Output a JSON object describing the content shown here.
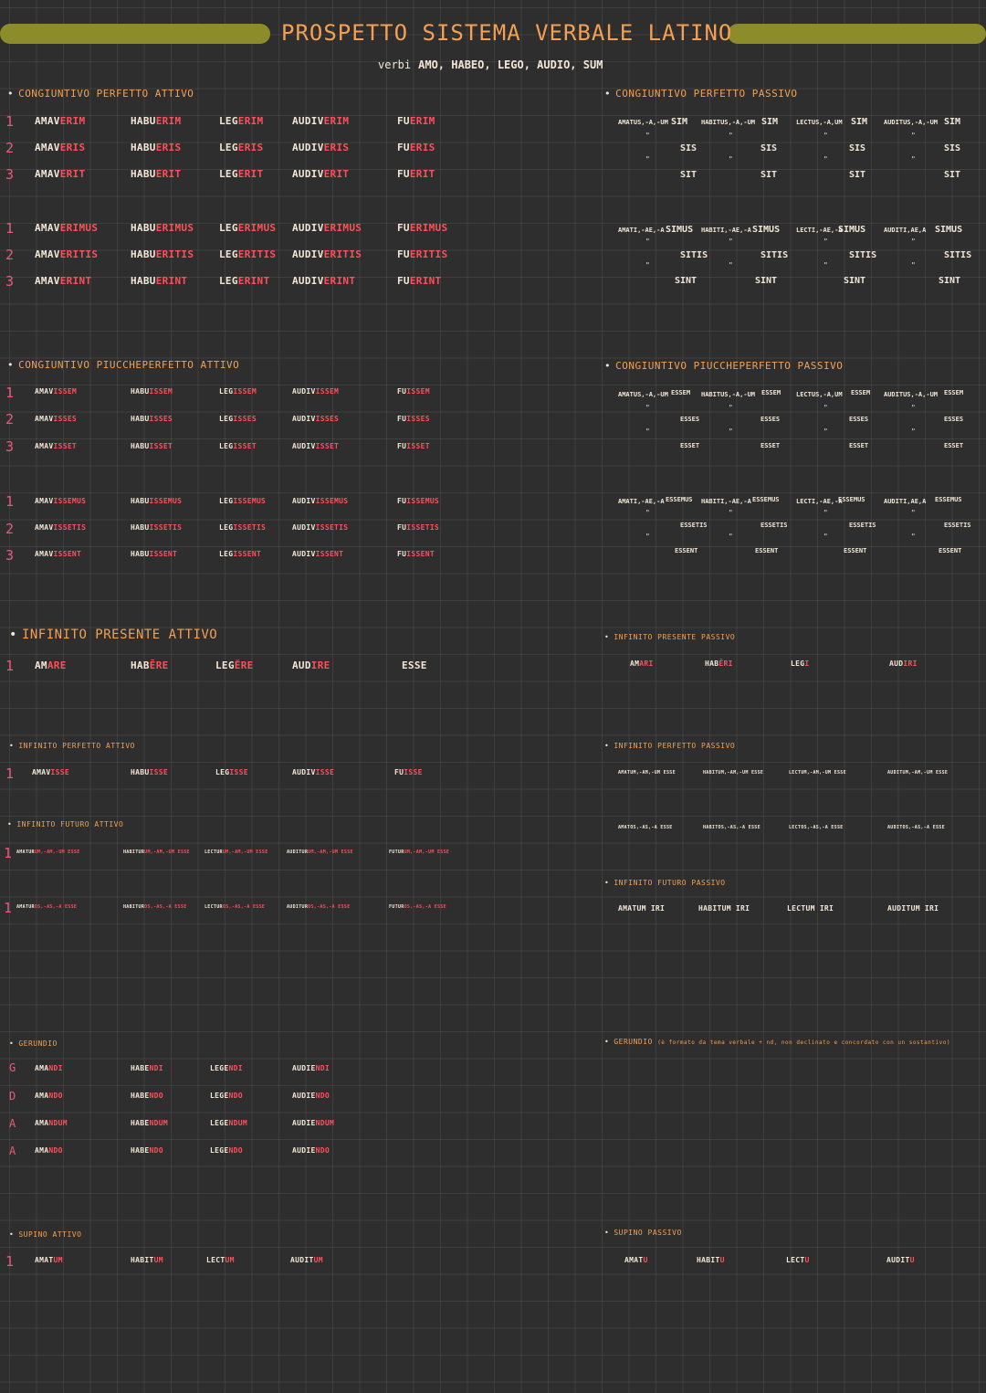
{
  "title": "PROSPETTO SISTEMA VERBALE LATINO",
  "subtitle": {
    "label": "verbi",
    "verbs": "AMO, HABEO, LEGO, AUDIO, SUM"
  },
  "colors": {
    "background": "#2e2e2e",
    "heading": "#f4a052",
    "ending": "#ff4f5a",
    "number": "#e85a7c",
    "bar": "#8c8c2a",
    "text": "#f2e6d6"
  },
  "sections": {
    "cong_perf_att": "CONGIUNTIVO PERFETTO ATTIVO",
    "cong_perf_pass": "CONGIUNTIVO PERFETTO PASSIVO",
    "cong_piuc_att": "CONGIUNTIVO PIUCCHEPERFETTO ATTIVO",
    "cong_piuc_pass": "CONGIUNTIVO PIUCCHEPERFETTO PASSIVO",
    "inf_pres_att": "INFINITO PRESENTE ATTIVO",
    "inf_pres_pass": "INFINITO PRESENTE PASSIVO",
    "inf_perf_att": "INFINITO PERFETTO ATTIVO",
    "inf_perf_pass": "INFINITO PERFETTO PASSIVO",
    "inf_fut_att": "INFINITO FUTURO ATTIVO",
    "inf_fut_pass": "INFINITO FUTURO PASSIVO",
    "gerundio_l": "GERUNDIO",
    "gerundio_r": "GERUNDIO",
    "gerundio_note": "(è formato da tema verbale + nd, non declinato e concordato con un sostantivo)",
    "supino_att": "SUPINO ATTIVO",
    "supino_pass": "SUPINO PASSIVO"
  },
  "nums": {
    "n1": "1",
    "n2": "2",
    "n3": "3",
    "g": "G",
    "d": "D",
    "a": "A",
    "ab": "A"
  },
  "cpa": {
    "r1": [
      [
        "AMAV",
        "ERIM"
      ],
      [
        "HABU",
        "ERIM"
      ],
      [
        "LEG",
        "ERIM"
      ],
      [
        "AUDIV",
        "ERIM"
      ],
      [
        "FU",
        "ERIM"
      ]
    ],
    "r2": [
      [
        "AMAV",
        "ERIS"
      ],
      [
        "HABU",
        "ERIS"
      ],
      [
        "LEG",
        "ERIS"
      ],
      [
        "AUDIV",
        "ERIS"
      ],
      [
        "FU",
        "ERIS"
      ]
    ],
    "r3": [
      [
        "AMAV",
        "ERIT"
      ],
      [
        "HABU",
        "ERIT"
      ],
      [
        "LEG",
        "ERIT"
      ],
      [
        "AUDIV",
        "ERIT"
      ],
      [
        "FU",
        "ERIT"
      ]
    ],
    "r4": [
      [
        "AMAV",
        "ERIMUS"
      ],
      [
        "HABU",
        "ERIMUS"
      ],
      [
        "LEG",
        "ERIMUS"
      ],
      [
        "AUDIV",
        "ERIMUS"
      ],
      [
        "FU",
        "ERIMUS"
      ]
    ],
    "r5": [
      [
        "AMAV",
        "ERITIS"
      ],
      [
        "HABU",
        "ERITIS"
      ],
      [
        "LEG",
        "ERITIS"
      ],
      [
        "AUDIV",
        "ERITIS"
      ],
      [
        "FU",
        "ERITIS"
      ]
    ],
    "r6": [
      [
        "AMAV",
        "ERINT"
      ],
      [
        "HABU",
        "ERINT"
      ],
      [
        "LEG",
        "ERINT"
      ],
      [
        "AUDIV",
        "ERINT"
      ],
      [
        "FU",
        "ERINT"
      ]
    ]
  },
  "cpp": {
    "p_sg": [
      "AMATUS,-A,-UM",
      "HABITUS,-A,-UM",
      "LECTUS,-A,UM",
      "AUDITUS,-A,-UM"
    ],
    "p_pl": [
      "AMATI,-AE,-A",
      "HABITI,-AE,-A",
      "LECTI,-AE,-A",
      "AUDITI,AE,A"
    ],
    "aux_sg": [
      "SIM",
      "SIS",
      "SIT"
    ],
    "aux_pl": [
      "SIMUS",
      "SITIS",
      "SINT"
    ]
  },
  "cppa": {
    "r1": [
      [
        "AMAV",
        "ISSEM"
      ],
      [
        "HABU",
        "ISSEM"
      ],
      [
        "LEG",
        "ISSEM"
      ],
      [
        "AUDIV",
        "ISSEM"
      ],
      [
        "FU",
        "ISSEM"
      ]
    ],
    "r2": [
      [
        "AMAV",
        "ISSES"
      ],
      [
        "HABU",
        "ISSES"
      ],
      [
        "LEG",
        "ISSES"
      ],
      [
        "AUDIV",
        "ISSES"
      ],
      [
        "FU",
        "ISSES"
      ]
    ],
    "r3": [
      [
        "AMAV",
        "ISSET"
      ],
      [
        "HABU",
        "ISSET"
      ],
      [
        "LEG",
        "ISSET"
      ],
      [
        "AUDIV",
        "ISSET"
      ],
      [
        "FU",
        "ISSET"
      ]
    ],
    "r4": [
      [
        "AMAV",
        "ISSEMUS"
      ],
      [
        "HABU",
        "ISSEMUS"
      ],
      [
        "LEG",
        "ISSEMUS"
      ],
      [
        "AUDIV",
        "ISSEMUS"
      ],
      [
        "FU",
        "ISSEMUS"
      ]
    ],
    "r5": [
      [
        "AMAV",
        "ISSETIS"
      ],
      [
        "HABU",
        "ISSETIS"
      ],
      [
        "LEG",
        "ISSETIS"
      ],
      [
        "AUDIV",
        "ISSETIS"
      ],
      [
        "FU",
        "ISSETIS"
      ]
    ],
    "r6": [
      [
        "AMAV",
        "ISSENT"
      ],
      [
        "HABU",
        "ISSENT"
      ],
      [
        "LEG",
        "ISSENT"
      ],
      [
        "AUDIV",
        "ISSENT"
      ],
      [
        "FU",
        "ISSENT"
      ]
    ]
  },
  "cppp": {
    "p_sg": [
      "AMATUS,-A,-UM",
      "HABITUS,-A,-UM",
      "LECTUS,-A,UM",
      "AUDITUS,-A,-UM"
    ],
    "p_pl": [
      "AMATI,-AE,-A",
      "HABITI,-AE,-A",
      "LECTI,-AE,-A",
      "AUDITI,AE,A"
    ],
    "aux_sg": [
      "ESSEM",
      "ESSES",
      "ESSET"
    ],
    "aux_pl": [
      "ESSEMUS",
      "ESSETIS",
      "ESSENT"
    ]
  },
  "ditto": "\"",
  "ipa": [
    [
      "AM",
      "ARE"
    ],
    [
      "HAB",
      "ĒRE"
    ],
    [
      "LEG",
      "ĔRE"
    ],
    [
      "AUD",
      "IRE"
    ],
    [
      "ESSE",
      ""
    ]
  ],
  "ipp": [
    [
      "AM",
      "ARI"
    ],
    [
      "HAB",
      "ĒRI"
    ],
    [
      "LEG",
      "I"
    ],
    [
      "AUD",
      "IRI"
    ]
  ],
  "iperfa": [
    [
      "AMAV",
      "ISSE"
    ],
    [
      "HABU",
      "ISSE"
    ],
    [
      "LEG",
      "ISSE"
    ],
    [
      "AUDIV",
      "ISSE"
    ],
    [
      "FU",
      "ISSE"
    ]
  ],
  "iperfp": {
    "sg": [
      "AMATUM,-AM,-UM ESSE",
      "HABITUM,-AM,-UM ESSE",
      "LECTUM,-AM,-UM ESSE",
      "AUDITUM,-AM,-UM ESSE"
    ],
    "pl": [
      "AMATOS,-AS,-A ESSE",
      "HABITOS,-AS,-A ESSE",
      "LECTOS,-AS,-A ESSE",
      "AUDITOS,-AS,-A ESSE"
    ]
  },
  "ifa": {
    "sg": [
      [
        "AMATUR",
        "UM,-AM,-UM ESSE"
      ],
      [
        "HABITUR",
        "UM,-AM,-UM ESSE"
      ],
      [
        "LECTUR",
        "UM,-AM,-UM ESSE"
      ],
      [
        "AUDITUR",
        "UM,-AM,-UM ESSE"
      ],
      [
        "FUTUR",
        "UM,-AM,-UM ESSE"
      ]
    ],
    "pl": [
      [
        "AMATUR",
        "OS,-AS,-A ESSE"
      ],
      [
        "HABITUR",
        "OS,-AS,-A ESSE"
      ],
      [
        "LECTUR",
        "OS,-AS,-A ESSE"
      ],
      [
        "AUDITUR",
        "OS,-AS,-A ESSE"
      ],
      [
        "FUTUR",
        "OS,-AS,-A ESSE"
      ]
    ]
  },
  "ifp": [
    "AMATUM IRI",
    "HABITUM IRI",
    "LECTUM IRI",
    "AUDITUM IRI"
  ],
  "ger": {
    "g": [
      [
        "AMA",
        "NDI"
      ],
      [
        "HABE",
        "NDI"
      ],
      [
        "LEGE",
        "NDI"
      ],
      [
        "AUDIE",
        "NDI"
      ]
    ],
    "d": [
      [
        "AMA",
        "NDO"
      ],
      [
        "HABE",
        "NDO"
      ],
      [
        "LEGE",
        "NDO"
      ],
      [
        "AUDIE",
        "NDO"
      ]
    ],
    "a": [
      [
        "AMA",
        "NDUM"
      ],
      [
        "HABE",
        "NDUM"
      ],
      [
        "LEGE",
        "NDUM"
      ],
      [
        "AUDIE",
        "NDUM"
      ]
    ],
    "ab": [
      [
        "AMA",
        "NDO"
      ],
      [
        "HABE",
        "NDO"
      ],
      [
        "LEGE",
        "NDO"
      ],
      [
        "AUDIE",
        "NDO"
      ]
    ]
  },
  "sup_att": [
    [
      "AMAT",
      "UM"
    ],
    [
      "HABIT",
      "UM"
    ],
    [
      "LECT",
      "UM"
    ],
    [
      "AUDIT",
      "UM"
    ]
  ],
  "sup_pass": [
    [
      "AMAT",
      "U"
    ],
    [
      "HABIT",
      "U"
    ],
    [
      "LECT",
      "U"
    ],
    [
      "AUDIT",
      "U"
    ]
  ]
}
